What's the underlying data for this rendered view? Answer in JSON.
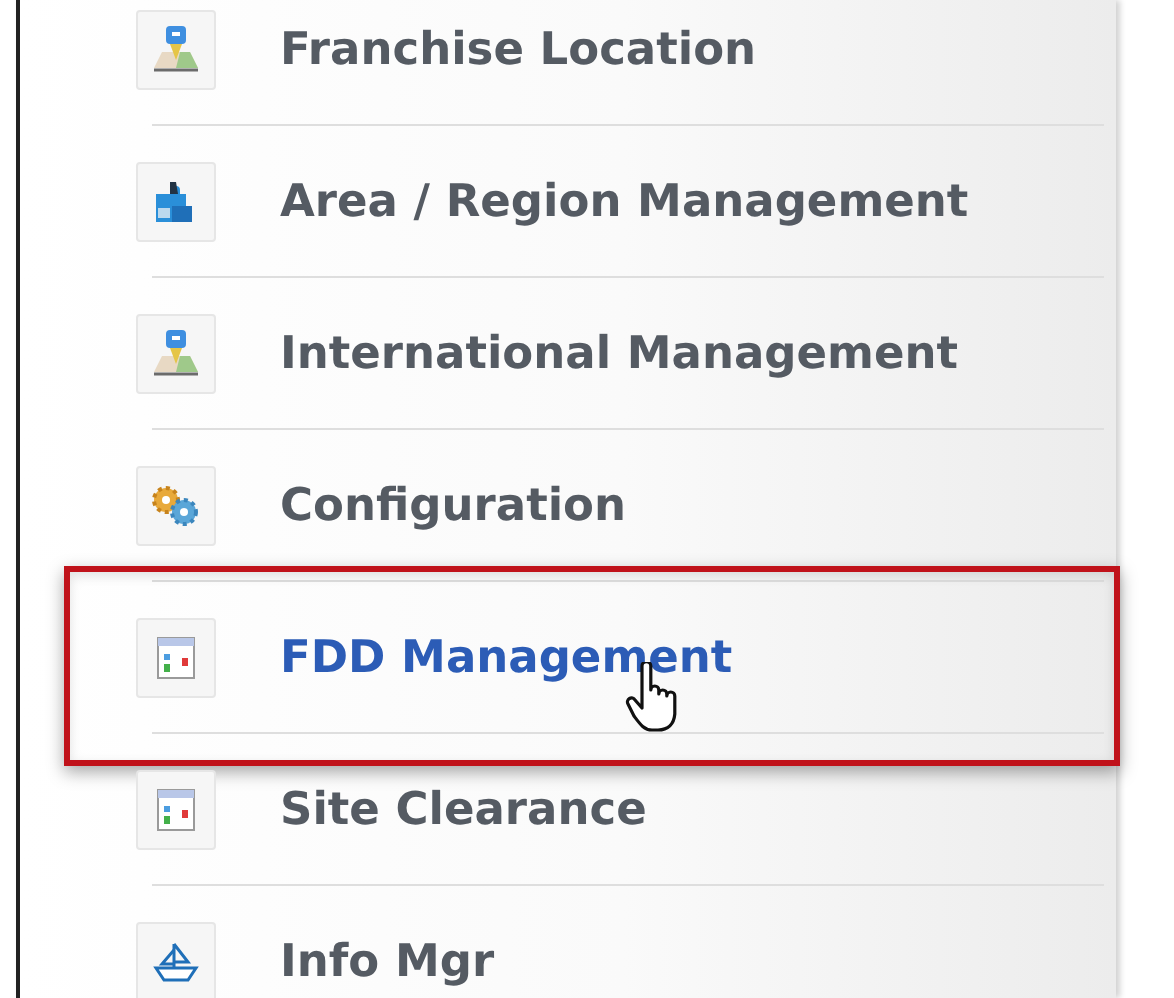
{
  "menu": {
    "items": [
      {
        "label": "Franchise Location",
        "selected": false
      },
      {
        "label": "Area / Region Management",
        "selected": false
      },
      {
        "label": "International Management",
        "selected": false
      },
      {
        "label": "Configuration",
        "selected": false
      },
      {
        "label": "FDD Management",
        "selected": true
      },
      {
        "label": "Site Clearance",
        "selected": false
      },
      {
        "label": "Info Mgr",
        "selected": false
      }
    ]
  }
}
